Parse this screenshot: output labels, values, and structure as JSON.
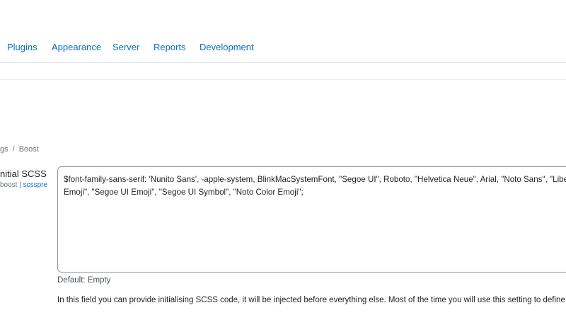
{
  "nav": {
    "tabs": [
      {
        "label": "Plugins"
      },
      {
        "label": "Appearance"
      },
      {
        "label": "Server"
      },
      {
        "label": "Reports"
      },
      {
        "label": "Development"
      }
    ]
  },
  "breadcrumb": {
    "items": [
      "gs",
      "Boost"
    ],
    "separator": "/"
  },
  "setting": {
    "label": "nitial SCSS",
    "sub_prefix": "boost |",
    "sub_link": "scsspre",
    "value_line1": "$font-family-sans-serif: 'Nunito Sans', -apple-system, BlinkMacSystemFont, \"Segoe UI\", Roboto, \"Helvetica Neue\", Arial, \"Noto Sans\", \"Liberation Sans\", sans-serif, \"Apple Color",
    "value_line2": "Emoji\", \"Segoe UI Emoji\", \"Segoe UI Symbol\", \"Noto Color Emoji\";",
    "default_note": "Default: Empty",
    "description": "In this field you can provide initialising SCSS code, it will be injected before everything else. Most of the time you will use this setting to define variables."
  },
  "colors": {
    "link": "#0f6cbf",
    "text": "#1d2125",
    "muted": "#6a737b",
    "border": "#8f959e"
  }
}
